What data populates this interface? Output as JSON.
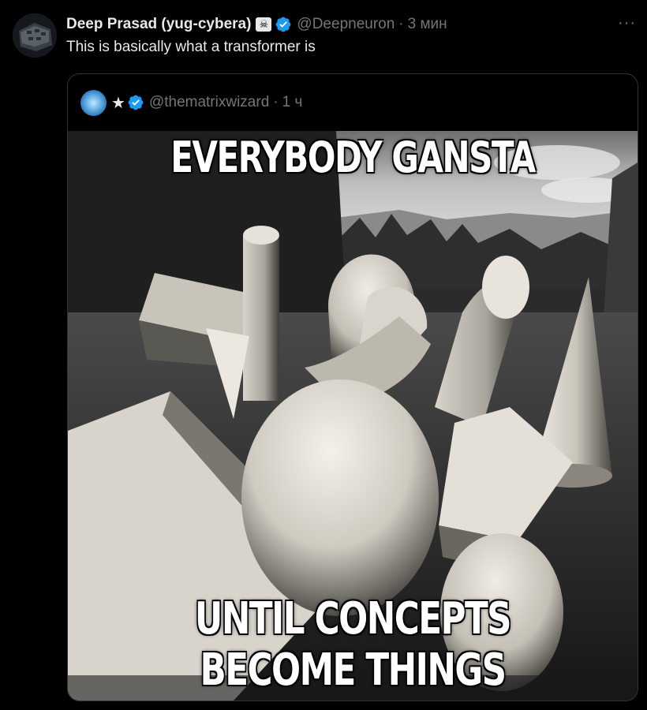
{
  "tweet": {
    "display_name": "Deep Prasad (yug-cybera)",
    "affiliation_icon": "skull-crossbones-icon",
    "affiliation_glyph": "☠",
    "handle": "@Deepneuron",
    "separator": "·",
    "time": "3 мин",
    "more_glyph": "···",
    "text": "This is basically what a transformer is"
  },
  "quote": {
    "star": "★",
    "handle": "@thematrixwizard",
    "separator": "·",
    "time": "1 ч",
    "image": {
      "top_caption": "EVERYBODY GANSTA",
      "bottom_caption": "UNTIL CONCEPTS BECOME THINGS"
    }
  },
  "colors": {
    "background": "#000000",
    "text_primary": "#e7e9ea",
    "text_secondary": "#71767b",
    "verified_blue": "#1d9bf0",
    "border": "#2f3336"
  }
}
